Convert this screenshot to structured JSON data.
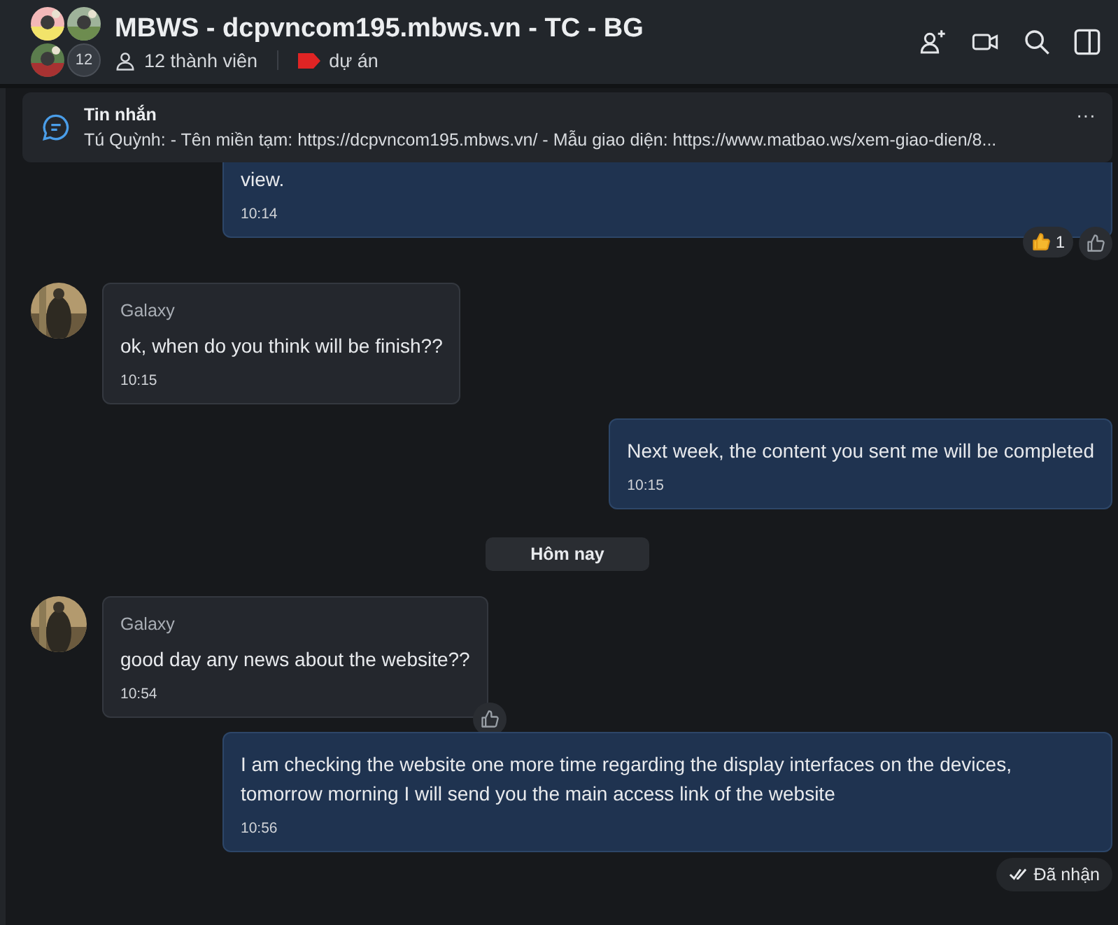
{
  "header": {
    "title": "MBWS - dcpvncom195.mbws.vn - TC - BG",
    "avatar_count": "12",
    "members": "12 thành viên",
    "tag": {
      "label": "dự án",
      "color": "#e02424"
    }
  },
  "pinned": {
    "label": "Tin nhắn",
    "text": "Tú Quỳnh: - Tên miền tạm: https://dcpvncom195.mbws.vn/ - Mẫu giao diện: https://www.matbao.ws/xem-giao-dien/8...",
    "more": "···"
  },
  "messages": [
    {
      "kind": "outgoing",
      "cut": true,
      "text": "view.",
      "time": "10:14",
      "reaction": {
        "count": "1"
      },
      "like": true
    },
    {
      "kind": "incoming",
      "sender": "Galaxy",
      "text": "ok, when do you think will be finish??",
      "time": "10:15",
      "like": false
    },
    {
      "kind": "outgoing",
      "cut": false,
      "text": "Next week, the content you sent me will be completed",
      "time": "10:15",
      "like": false
    },
    {
      "kind": "date",
      "text": "Hôm nay"
    },
    {
      "kind": "incoming",
      "sender": "Galaxy",
      "text": "good day any news about the website??",
      "time": "10:54",
      "like": true
    },
    {
      "kind": "outgoing",
      "cut": false,
      "text": "I am checking the website one more time regarding the display interfaces on the devices, tomorrow morning I will send you the main access link of the website",
      "time": "10:56",
      "like": false
    }
  ],
  "status": "Đã nhận"
}
